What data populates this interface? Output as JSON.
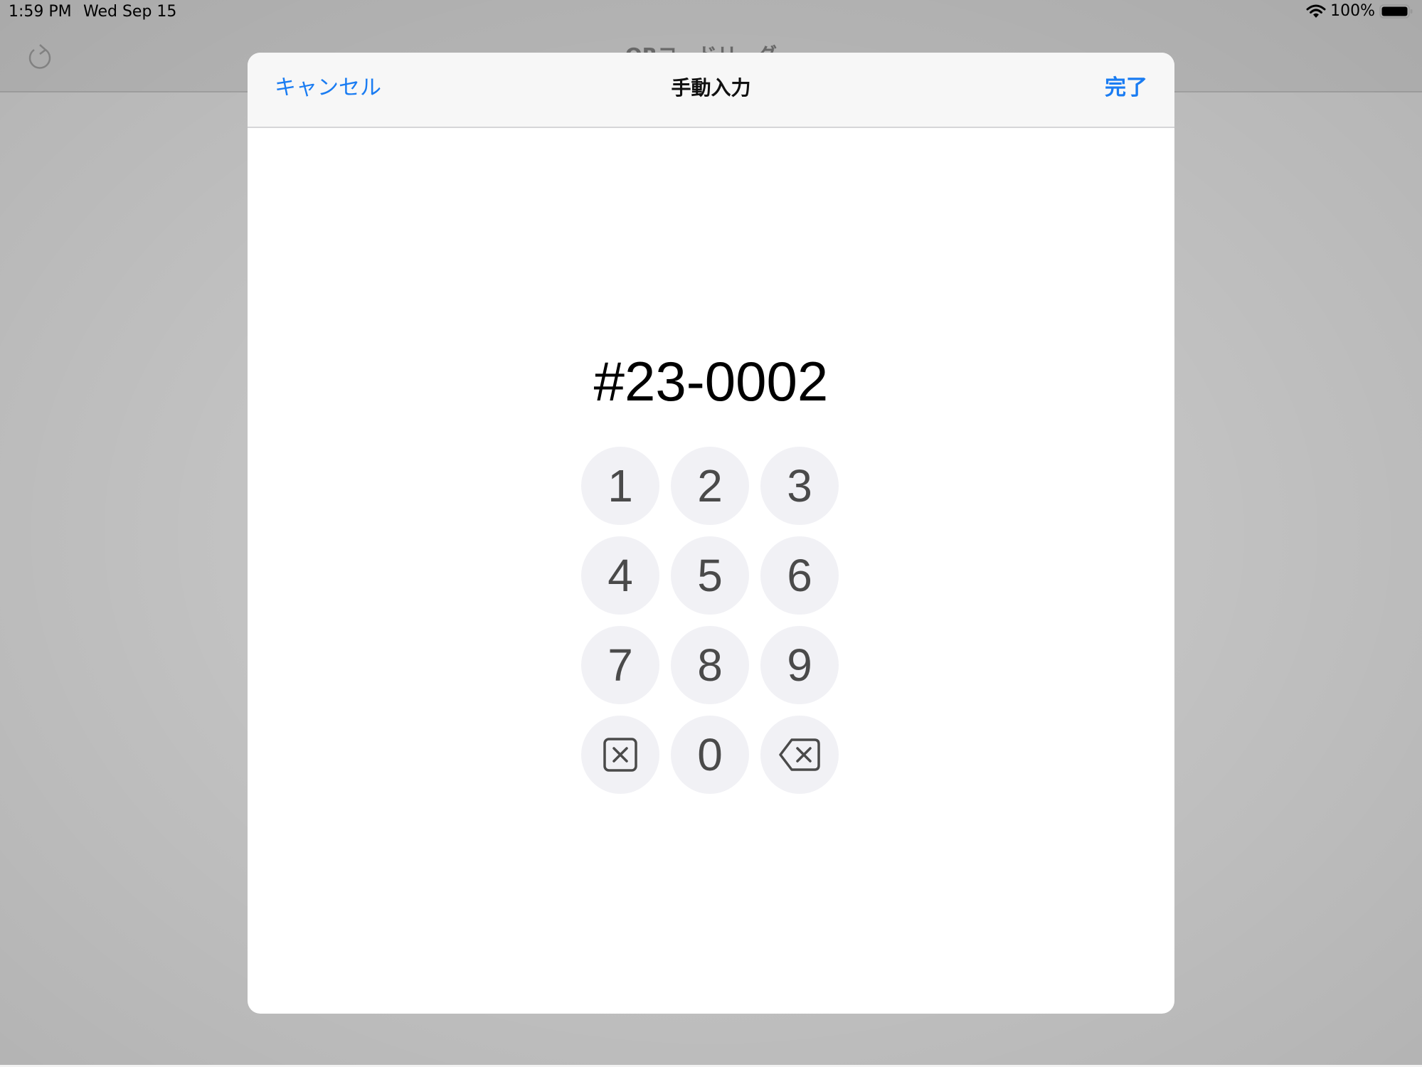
{
  "status_bar": {
    "time": "1:59 PM",
    "date": "Wed Sep 15",
    "battery": "100%",
    "wifi_icon": "wifi-icon",
    "battery_icon": "battery-full-icon"
  },
  "background_app": {
    "title": "QRコードリーダー",
    "refresh_icon": "refresh-icon"
  },
  "sheet": {
    "cancel_label": "キャンセル",
    "title": "手動入力",
    "done_label": "完了",
    "code_value": "#23-0002"
  },
  "keypad": {
    "keys": [
      "1",
      "2",
      "3",
      "4",
      "5",
      "6",
      "7",
      "8",
      "9"
    ],
    "zero": "0",
    "clear_icon": "clear-icon",
    "backspace_icon": "backspace-icon"
  },
  "colors": {
    "accent": "#1a7cf2",
    "key_background": "#f1f1f5",
    "key_text": "#4a4a4a"
  }
}
